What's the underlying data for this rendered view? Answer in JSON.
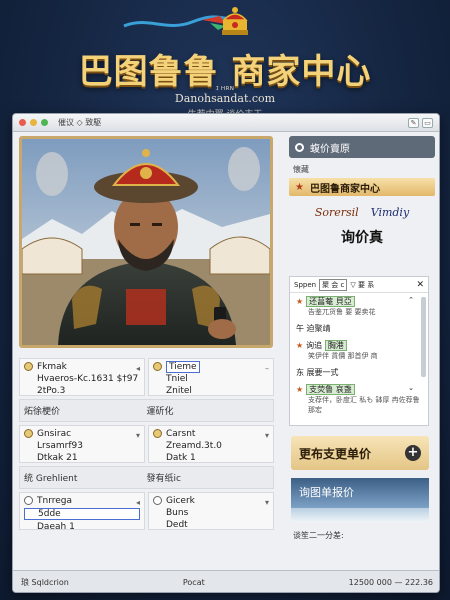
{
  "banner": {
    "title": "巴图鲁鲁 商家中心",
    "url_small": "ɪ ʜʀɴ",
    "url": "Danohsandat.com",
    "slogan": "牛荐中翼  谈价支王"
  },
  "window": {
    "title": "催议 ◇ 致駆",
    "controls": [
      "✎",
      "▭"
    ]
  },
  "properties": {
    "row1": [
      {
        "label": "Fkmak",
        "line2": "Hvaeros-Kc.1631 $†97",
        "line3": "2tPo.3"
      },
      {
        "label": "Tieme",
        "line2": "Tniel",
        "line3": "Znitel"
      }
    ],
    "section1": [
      "炻徐梗价",
      "運斫化"
    ],
    "row2": [
      {
        "label": "Gnsirac",
        "line2": "Lrsamrf93",
        "line3": "Dtkak 21"
      },
      {
        "label": "Carsnt",
        "line2": "Zreamd.3t.0",
        "line3": "Datk 1"
      }
    ],
    "section2": [
      "统 Grehlient",
      "發有纸ic"
    ],
    "row3": [
      {
        "label": "Tnrrega",
        "line2": "5dde",
        "line3": "Daeah 1"
      },
      {
        "label": "Gicerk",
        "line2": "Buns",
        "line3": "Dedt"
      }
    ]
  },
  "status": {
    "left": "琅 Sqldcrion",
    "mid": "Pocat",
    "right": "12500 000 —  222.36"
  },
  "sidebar": {
    "search_label": "蝮价賣原",
    "label": "懐藏",
    "brand": "巴图鲁商家中心",
    "logo1": "Sorersil",
    "logo2": "Vimdiy",
    "inquiry_title": "询价真",
    "panel": {
      "title": "Sppen",
      "tag": "聚 会 c",
      "tail": "▽ 要 系",
      "items": [
        {
          "star": "★",
          "text": "还菖菴 貝亞",
          "note": "告鉴兀货鲁  要 要卖花",
          "hl": true
        },
        {
          "star": "",
          "text": "午 迫聚靖",
          "note": "",
          "hl": false
        },
        {
          "star": "★",
          "text": "询追",
          "badge": "胸港",
          "note": "笑伊伴 貨價 那首伊 商",
          "hl": false
        },
        {
          "star": "",
          "text": "东 展要一式",
          "note": "",
          "hl": false
        },
        {
          "star": "★",
          "text": "支荧鲁 哀盏",
          "note": "支荐伴，卧度汇 私も 缽厚 冉佐荐鲁 那宏",
          "hl": true
        }
      ]
    },
    "price_button": "更布支更单价",
    "quote_card": "询图单报价",
    "footer": "谈笙二一分差:"
  }
}
